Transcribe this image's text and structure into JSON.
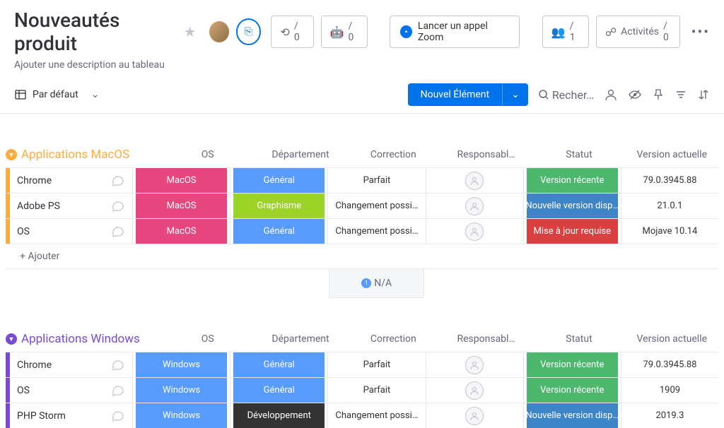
{
  "header": {
    "title": "Nouveautés produit",
    "description": "Ajouter une description au tableau",
    "pills": {
      "link": "/ 0",
      "robot": "/ 0",
      "people": "/ 1",
      "activities_label": "Activités",
      "activities_count": "/ 0"
    },
    "zoom": "Lancer un appel Zoom"
  },
  "toolbar": {
    "view": "Par défaut",
    "new_button": "Nouvel Élément",
    "search": "Recher…"
  },
  "columns": [
    "OS",
    "Département",
    "Correction",
    "Responsabl…",
    "Statut",
    "Version actuelle"
  ],
  "add_row": "+ Ajouter",
  "na": "N/A",
  "groups": [
    {
      "title": "Applications MacOS",
      "color_class": "c-orange",
      "bar_class": "b-orange",
      "rows": [
        {
          "name": "Chrome",
          "os": "MacOS",
          "os_bg": "bg-pink",
          "dept": "Général",
          "dept_bg": "bg-blue",
          "corr": "Parfait",
          "status": "Version récente",
          "status_bg": "bg-green",
          "ver": "79.0.3945.88"
        },
        {
          "name": "Adobe PS",
          "os": "MacOS",
          "os_bg": "bg-pink",
          "dept": "Graphisme",
          "dept_bg": "bg-lime",
          "corr": "Changement possi…",
          "status": "Nouvelle version disp…",
          "status_bg": "bg-blue2",
          "ver": "21.0.1"
        },
        {
          "name": "OS",
          "os": "MacOS",
          "os_bg": "bg-pink",
          "dept": "Général",
          "dept_bg": "bg-blue",
          "corr": "Changement possi…",
          "status": "Mise à jour requise",
          "status_bg": "bg-red",
          "ver": "Mojave 10.14"
        }
      ]
    },
    {
      "title": "Applications Windows",
      "color_class": "c-purple",
      "bar_class": "b-purple",
      "rows": [
        {
          "name": "Chrome",
          "os": "Windows",
          "os_bg": "bg-windows",
          "dept": "Général",
          "dept_bg": "bg-blue",
          "corr": "Parfait",
          "status": "Version récente",
          "status_bg": "bg-green",
          "ver": "79.0.3945.88"
        },
        {
          "name": "OS",
          "os": "Windows",
          "os_bg": "bg-windows",
          "dept": "Général",
          "dept_bg": "bg-blue",
          "corr": "Parfait",
          "status": "Version récente",
          "status_bg": "bg-green",
          "ver": "1909"
        },
        {
          "name": "PHP Storm",
          "os": "Windows",
          "os_bg": "bg-windows",
          "dept": "Développement",
          "dept_bg": "bg-dark",
          "corr": "Changement possi…",
          "status": "Nouvelle version disp…",
          "status_bg": "bg-blue2",
          "ver": "2019.3"
        }
      ]
    }
  ]
}
